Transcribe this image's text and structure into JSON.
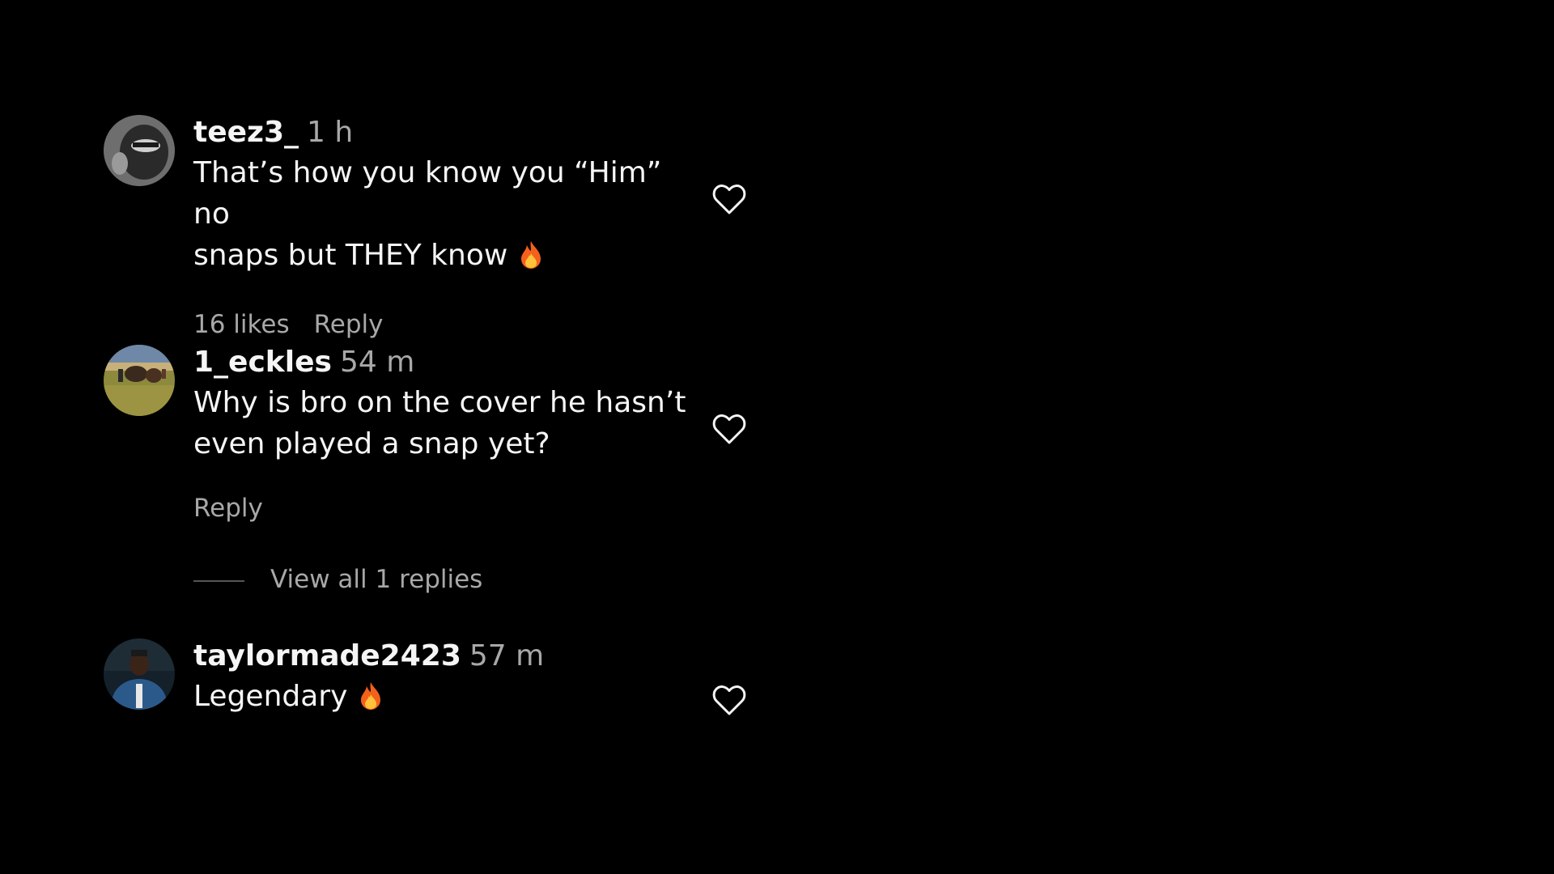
{
  "comments": [
    {
      "username": "teez3_",
      "time": "1 h",
      "text_line1": "That’s how you know you “Him” no",
      "text_line2": "snaps but THEY know",
      "emoji": "fire-icon",
      "likes": "16 likes",
      "reply_label": "Reply"
    },
    {
      "username": "1_eckles",
      "time": "54 m",
      "text_line1": "Why is bro on the cover he hasn’t",
      "text_line2": "even played a snap yet?",
      "reply_label": "Reply",
      "view_replies": "View all 1 replies"
    },
    {
      "username": "taylormade2423",
      "time": "57 m",
      "text_line1": "Legendary",
      "emoji": "fire-icon"
    }
  ],
  "colors": {
    "background": "#000000",
    "primary_text": "#f5f5f5",
    "secondary_text": "#a8a8a8"
  },
  "icons": [
    "heart-outline-icon",
    "fire-icon"
  ]
}
